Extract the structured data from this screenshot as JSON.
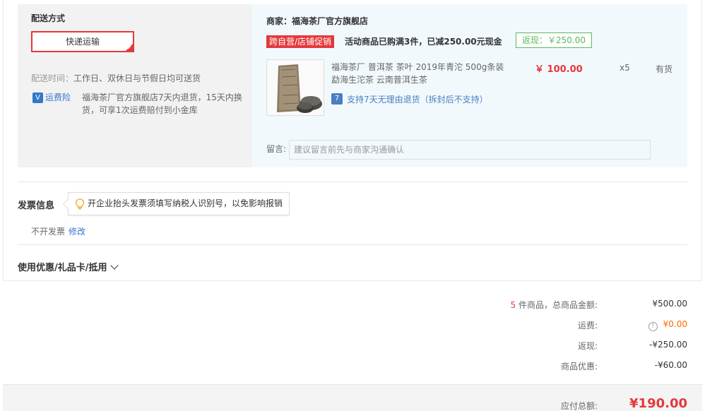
{
  "shipping": {
    "title": "配送方式",
    "option": "快递运输",
    "time_label": "配送时间：",
    "time_value": "工作日、双休日与节假日均可送货",
    "insurance_icon": "V",
    "insurance_label": "运费险",
    "insurance_desc": "福海茶厂官方旗舰店7天内退货，15天内换货，可享1次运费赔付到小金库"
  },
  "shop": {
    "name": "商家：福海茶厂官方旗舰店",
    "promo_tag": "跨自营/店铺促销",
    "promo_text": "活动商品已购满3件，已减250.00元现金",
    "rebate": "返现：￥250.00",
    "product": {
      "image_icon": "tea-package-image",
      "title": "福海茶厂 普洱茶 茶叶 2019年青沱 500g条装 勐海生沱茶 云南普洱生茶",
      "price": "￥ 100.00",
      "qty": "x5",
      "stock": "有货",
      "return_icon": "7",
      "return_text": "支持7天无理由退货（拆封后不支持）"
    },
    "note_label": "留言:",
    "note_placeholder": "建议留言前先与商家沟通确认"
  },
  "invoice": {
    "title": "发票信息",
    "tip": "开企业抬头发票须填写纳税人识别号，以免影响报销",
    "status": "不开发票",
    "edit": "修改"
  },
  "coupon": {
    "label": "使用优惠/礼品卡/抵用"
  },
  "summary": {
    "count": "5",
    "count_label_suffix": " 件商品，总商品金额:",
    "goods_total": "¥500.00",
    "freight_label": "运费:",
    "freight_icon": "!",
    "freight": "¥0.00",
    "rebate_label": "返现:",
    "rebate": "-¥250.00",
    "discount_label": "商品优惠:",
    "discount": "-¥60.00",
    "total_label": "应付总额:",
    "total": "¥190.00"
  },
  "colors": {
    "accent": "#e4393c",
    "link": "#3377cc",
    "warning": "#ff6600",
    "rebate": "#5cb85c"
  }
}
